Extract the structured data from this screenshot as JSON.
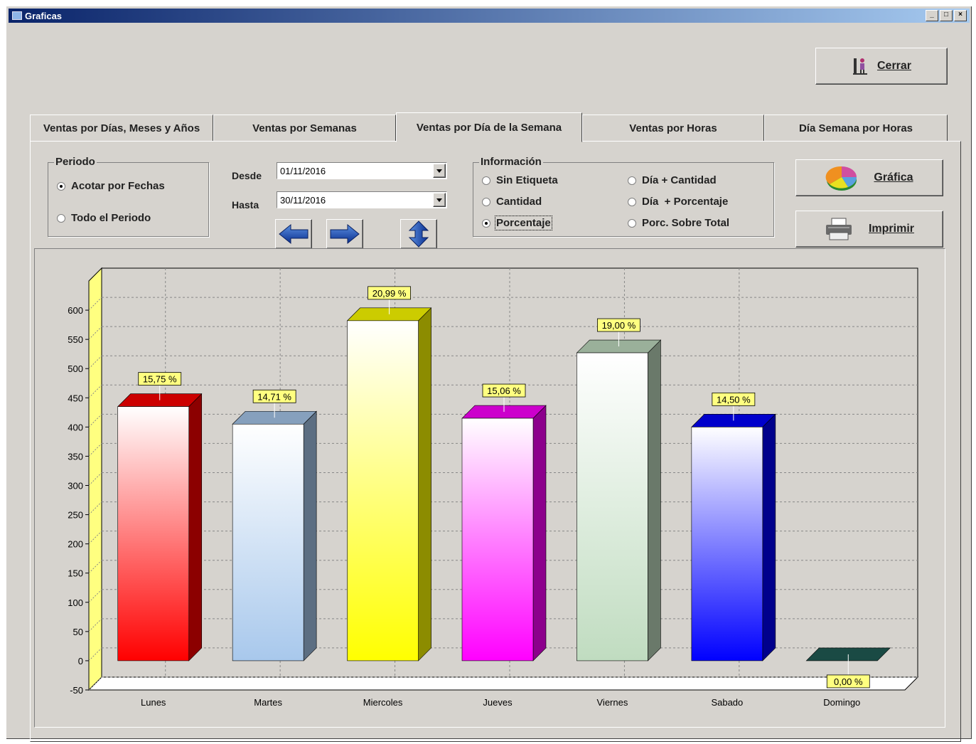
{
  "window": {
    "title": "Graficas"
  },
  "buttons": {
    "close": "Cerrar",
    "chart": "Gráfica",
    "print": "Imprimir"
  },
  "tabs": [
    {
      "label": "Ventas por Días, Meses y Años",
      "active": false
    },
    {
      "label": "Ventas por Semanas",
      "active": false
    },
    {
      "label": "Ventas por Día de la Semana",
      "active": true
    },
    {
      "label": "Ventas por Horas",
      "active": false
    },
    {
      "label": "Día Semana por Horas",
      "active": false
    }
  ],
  "periodo": {
    "title": "Periodo",
    "options": [
      {
        "label": "Acotar por Fechas",
        "selected": true
      },
      {
        "label": "Todo el Periodo",
        "selected": false
      }
    ]
  },
  "dates": {
    "desde_label": "Desde",
    "desde_value": "01/11/2016",
    "hasta_label": "Hasta",
    "hasta_value": "30/11/2016"
  },
  "informacion": {
    "title": "Información",
    "options": [
      {
        "label": "Sin Etiqueta",
        "selected": false
      },
      {
        "label": "Cantidad",
        "selected": false
      },
      {
        "label": "Porcentaje",
        "selected": true
      },
      {
        "label": "Día + Cantidad",
        "selected": false
      },
      {
        "label": "Día  + Porcentaje",
        "selected": false
      },
      {
        "label": "Porc. Sobre Total",
        "selected": false
      }
    ]
  },
  "icons": {
    "close": "exit-person-icon",
    "chart": "pie-chart-icon",
    "print": "printer-icon",
    "prev": "arrow-left-icon",
    "next": "arrow-right-icon",
    "swap": "arrow-up-down-icon"
  },
  "chart_data": {
    "type": "bar",
    "categories": [
      "Lunes",
      "Martes",
      "Miercoles",
      "Jueves",
      "Viernes",
      "Sabado",
      "Domingo"
    ],
    "values": [
      435,
      405,
      582,
      415,
      527,
      400,
      0
    ],
    "labels": [
      "15,75 %",
      "14,71 %",
      "20,99 %",
      "15,06 %",
      "19,00 %",
      "14,50 %",
      "0,00 %"
    ],
    "colors": [
      "#ff0000",
      "#a8c8ec",
      "#ffff00",
      "#ff00ff",
      "#c0dcc0",
      "#0000ff",
      "#1a4a44"
    ],
    "yticks": [
      -50,
      0,
      50,
      100,
      150,
      200,
      250,
      300,
      350,
      400,
      450,
      500,
      550,
      600
    ],
    "ylim": [
      -50,
      650
    ],
    "grid": true,
    "title": "",
    "xlabel": "",
    "ylabel": ""
  }
}
